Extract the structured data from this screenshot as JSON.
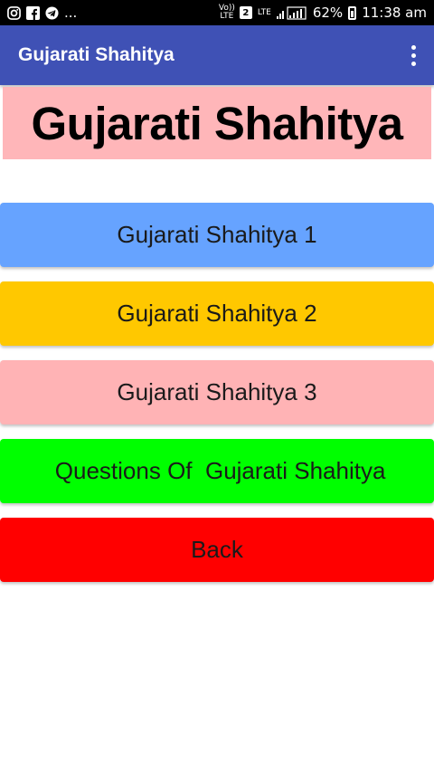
{
  "status_bar": {
    "left_icons": [
      "instagram-icon",
      "facebook-icon",
      "telegram-icon"
    ],
    "more": "...",
    "volte": "Vo)) LTE",
    "sim": "2",
    "lte": "LTE",
    "battery": "62%",
    "time": "11:38 am"
  },
  "app_bar": {
    "title": "Gujarati Shahitya",
    "menu_icon": "more-vert-icon"
  },
  "header": {
    "text": "Gujarati Shahitya",
    "bg": "#ffb6b9"
  },
  "buttons": [
    {
      "label": "Gujarati Shahitya 1",
      "color": "#66a3ff"
    },
    {
      "label": "Gujarati Shahitya 2",
      "color": "#ffc800"
    },
    {
      "label": "Gujarati Shahitya 3",
      "color": "#ffb3b5"
    },
    {
      "label": " Questions Of  Gujarati Shahitya",
      "color": "#00ff00"
    },
    {
      "label": "Back",
      "color": "#ff0000"
    }
  ],
  "colors": {
    "app_bar": "#3f51b5",
    "status_bar": "#000000"
  }
}
